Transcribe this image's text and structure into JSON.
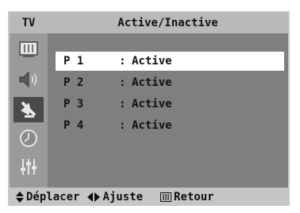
{
  "header": {
    "source_label": "TV",
    "title": "Active/Inactive"
  },
  "sidebar": {
    "items": [
      {
        "icon": "picture-icon",
        "selected": false
      },
      {
        "icon": "sound-icon",
        "selected": false
      },
      {
        "icon": "channel-antenna-icon",
        "selected": true
      },
      {
        "icon": "clock-icon",
        "selected": false
      },
      {
        "icon": "setup-sliders-icon",
        "selected": false
      }
    ]
  },
  "channels": [
    {
      "program": "P 1",
      "separator": ":",
      "status": "Active",
      "selected": true
    },
    {
      "program": "P 2",
      "separator": ":",
      "status": "Active",
      "selected": false
    },
    {
      "program": "P 3",
      "separator": ":",
      "status": "Active",
      "selected": false
    },
    {
      "program": "P 4",
      "separator": ":",
      "status": "Active",
      "selected": false
    }
  ],
  "footer": {
    "move_label": "Déplacer",
    "adjust_label": "Ajuste",
    "return_label": "Retour"
  },
  "colors": {
    "title_bar": "#b9b9b9",
    "sidebar": "#9a9a9a",
    "content": "#7f7f7f",
    "footer": "#c5c5c5",
    "selected_row": "#ffffff",
    "selected_icon": "#4a4a4a"
  }
}
